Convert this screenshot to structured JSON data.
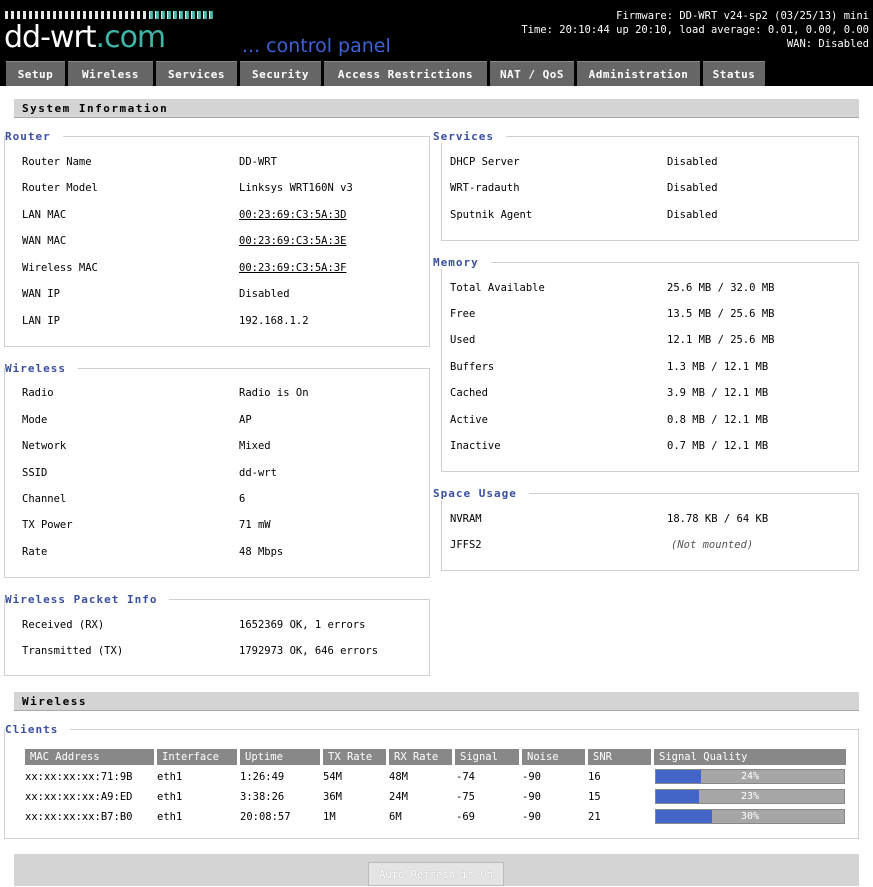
{
  "header": {
    "logo_text": "dd-wrt",
    "logo_dot": ".com",
    "subtitle": "... control panel",
    "firmware": "Firmware: DD-WRT v24-sp2 (03/25/13) mini",
    "time": "Time: 20:10:44 up 20:10, load average: 0.01, 0.00, 0.00",
    "wan": "WAN: Disabled"
  },
  "tabs": [
    "Setup",
    "Wireless",
    "Services",
    "Security",
    "Access Restrictions",
    "NAT / QoS",
    "Administration",
    "Status"
  ],
  "sections": {
    "system_info": "System Information",
    "wireless": "Wireless"
  },
  "router": {
    "legend": "Router",
    "rows": [
      {
        "k": "Router Name",
        "v": "DD-WRT"
      },
      {
        "k": "Router Model",
        "v": "Linksys WRT160N v3"
      },
      {
        "k": "LAN MAC",
        "v": "00:23:69:C3:5A:3D"
      },
      {
        "k": "WAN MAC",
        "v": "00:23:69:C3:5A:3E"
      },
      {
        "k": "Wireless MAC",
        "v": "00:23:69:C3:5A:3F"
      },
      {
        "k": "WAN IP",
        "v": "Disabled"
      },
      {
        "k": "LAN IP",
        "v": "192.168.1.2"
      }
    ]
  },
  "wireless": {
    "legend": "Wireless",
    "rows": [
      {
        "k": "Radio",
        "v": "Radio is On"
      },
      {
        "k": "Mode",
        "v": "AP"
      },
      {
        "k": "Network",
        "v": "Mixed"
      },
      {
        "k": "SSID",
        "v": "dd-wrt"
      },
      {
        "k": "Channel",
        "v": "6"
      },
      {
        "k": "TX Power",
        "v": "71 mW"
      },
      {
        "k": "Rate",
        "v": "48 Mbps"
      }
    ]
  },
  "packet": {
    "legend": "Wireless Packet Info",
    "rows": [
      {
        "k": "Received (RX)",
        "v": "1652369 OK, 1 errors"
      },
      {
        "k": "Transmitted (TX)",
        "v": "1792973 OK, 646 errors"
      }
    ]
  },
  "services": {
    "legend": "Services",
    "rows": [
      {
        "k": "DHCP Server",
        "v": "Disabled"
      },
      {
        "k": "WRT-radauth",
        "v": "Disabled"
      },
      {
        "k": "Sputnik Agent",
        "v": "Disabled"
      }
    ]
  },
  "memory": {
    "legend": "Memory",
    "rows": [
      {
        "k": "Total Available",
        "v": "25.6 MB / 32.0 MB"
      },
      {
        "k": "Free",
        "v": "13.5 MB / 25.6 MB"
      },
      {
        "k": "Used",
        "v": "12.1 MB / 25.6 MB"
      },
      {
        "k": "Buffers",
        "v": "1.3 MB / 12.1 MB"
      },
      {
        "k": "Cached",
        "v": "3.9 MB / 12.1 MB"
      },
      {
        "k": "Active",
        "v": "0.8 MB / 12.1 MB"
      },
      {
        "k": "Inactive",
        "v": "0.7 MB / 12.1 MB"
      }
    ]
  },
  "space": {
    "legend": "Space Usage",
    "rows": [
      {
        "k": "NVRAM",
        "v": "18.78 KB / 64 KB"
      },
      {
        "k": "JFFS2",
        "v": "(Not mounted)"
      }
    ]
  },
  "clients": {
    "legend": "Clients",
    "headers": [
      "MAC Address",
      "Interface",
      "Uptime",
      "TX Rate",
      "RX Rate",
      "Signal",
      "Noise",
      "SNR",
      "Signal Quality"
    ],
    "rows": [
      {
        "mac": "xx:xx:xx:xx:71:9B",
        "iface": "eth1",
        "uptime": "1:26:49",
        "tx": "54M",
        "rx": "48M",
        "signal": "-74",
        "noise": "-90",
        "snr": "16",
        "quality": "24%",
        "quality_pct": 24
      },
      {
        "mac": "xx:xx:xx:xx:A9:ED",
        "iface": "eth1",
        "uptime": "3:38:26",
        "tx": "36M",
        "rx": "24M",
        "signal": "-75",
        "noise": "-90",
        "snr": "15",
        "quality": "23%",
        "quality_pct": 23
      },
      {
        "mac": "xx:xx:xx:xx:B7:B0",
        "iface": "eth1",
        "uptime": "20:08:57",
        "tx": "1M",
        "rx": "6M",
        "signal": "-69",
        "noise": "-90",
        "snr": "21",
        "quality": "30%",
        "quality_pct": 30
      }
    ]
  },
  "auto_refresh_label": "Auto-Refresh is On"
}
